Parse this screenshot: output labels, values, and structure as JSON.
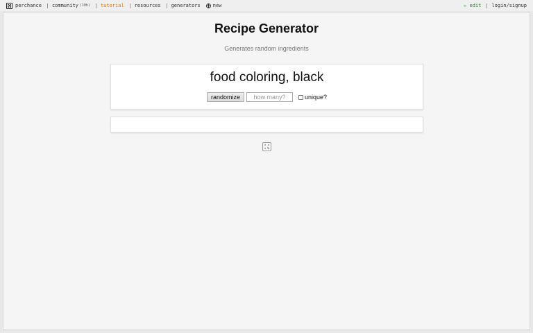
{
  "nav": {
    "brand": "perchance",
    "community": "community",
    "community_count": "(10h)",
    "tutorial": "tutorial",
    "resources": "resources",
    "generators": "generators",
    "new": "new",
    "edit": "✏ edit",
    "login": "login/signup",
    "colors": {
      "tutorial": "#e07a10",
      "edit": "#2f8a2f"
    }
  },
  "page": {
    "title": "Recipe Generator",
    "subtitle": "Generates random ingredients",
    "result": "food coloring, black",
    "randomize_label": "randomize",
    "count_placeholder": "how many?",
    "unique_label": "unique?"
  }
}
